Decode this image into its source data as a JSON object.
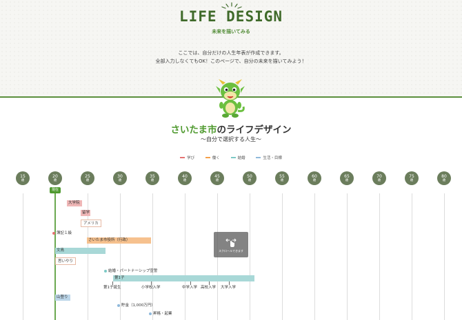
{
  "hero": {
    "logo": "LIFE DESIGN",
    "logo_sub": "未来を描いてみる",
    "intro_line1": "ここでは、自分だけの人生年表が作成できます。",
    "intro_line2": "全部入力しなくてもOK！このページで、自分の未来を描いてみよう！"
  },
  "plan": {
    "title_city": "さいたま市",
    "title_rest": "のライフデザイン",
    "subtitle": "〜自分で選択する人生〜"
  },
  "legend": [
    {
      "label": "学び",
      "color": "#e57373"
    },
    {
      "label": "働く",
      "color": "#f5a04a"
    },
    {
      "label": "結婚",
      "color": "#7cc9c5"
    },
    {
      "label": "生活・目標",
      "color": "#8fb9db"
    }
  ],
  "timeline": {
    "unit": "歳",
    "ages": [
      "15",
      "20",
      "25",
      "30",
      "35",
      "40",
      "45",
      "50",
      "55",
      "60",
      "65",
      "70",
      "75",
      "80"
    ],
    "now_label": "現在",
    "scroll_hint": "スクロールできます",
    "events": {
      "college": "大学院",
      "study_abroad": "留学",
      "america": "アメリカ",
      "bookkeeping": "簿記１級",
      "job": "さいたま市役所（行政）",
      "car": "文鳥",
      "kindness": "思いやり",
      "marriage": "結婚・パートナーシップ宣誓",
      "child1": "第1子",
      "born": "第1子誕生",
      "elementary": "小学校入学",
      "junior": "中学入学",
      "high": "高校入学",
      "university": "大学入学",
      "mountain": "山登り",
      "savings": "貯金（1,000万円）",
      "retire": "昇格・起業"
    }
  }
}
